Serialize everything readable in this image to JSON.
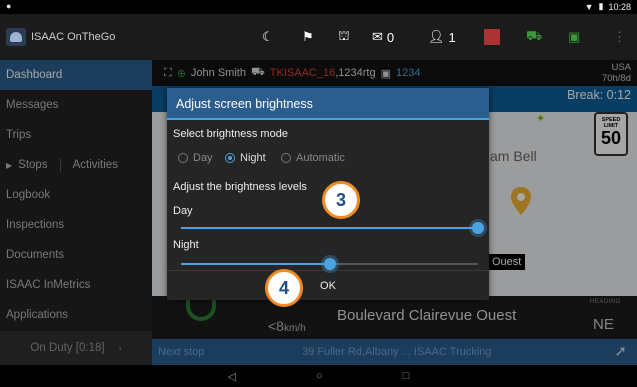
{
  "status_bar": {
    "time": "10:28"
  },
  "app": {
    "brand": "ISAAC OnTheGo",
    "messages_count": "0",
    "users_count": "1"
  },
  "sidebar": {
    "items": [
      {
        "label": "Dashboard",
        "active": true
      },
      {
        "label": "Messages"
      },
      {
        "label": "Trips"
      },
      {
        "label": "Stops",
        "label2": "Activities"
      },
      {
        "label": "Logbook"
      },
      {
        "label": "Inspections"
      },
      {
        "label": "Documents"
      },
      {
        "label": "ISAAC InMetrics"
      },
      {
        "label": "Applications"
      }
    ],
    "duty_status": "On Duty [0:18]"
  },
  "driver_bar": {
    "driver": "John Smith",
    "vehicle": "TKISAAC_16",
    "trip": ",1234rtg",
    "trailer": "1234",
    "region": "USA",
    "cycle": "70h/8d"
  },
  "map": {
    "break": "Break: 0:12",
    "speed_limit_label": "SPEED LIMIT",
    "speed_limit": "50",
    "street_partial": "am Bell",
    "ouest_label": "Ouest"
  },
  "bottom": {
    "speed": "<8",
    "speed_unit": "km/h",
    "street": "Boulevard Clairevue Ouest",
    "heading_label": "HEADING",
    "heading": "NE"
  },
  "next_stop": {
    "label": "Next stop",
    "address": "39 Fuller Rd,Albany ... ISAAC Trucking"
  },
  "dialog": {
    "title": "Adjust screen brightness",
    "mode_label": "Select brightness mode",
    "modes": [
      "Day",
      "Night",
      "Automatic"
    ],
    "selected_mode": "Night",
    "levels_label": "Adjust the brightness levels",
    "day_label": "Day",
    "day_level": 1.0,
    "night_label": "Night",
    "night_level": 0.5,
    "ok_label": "OK"
  },
  "callouts": [
    "3",
    "4"
  ],
  "colors": {
    "accent": "#4aa3e0",
    "header_blue": "#2b5d8e",
    "callout_border": "#f08a24"
  }
}
